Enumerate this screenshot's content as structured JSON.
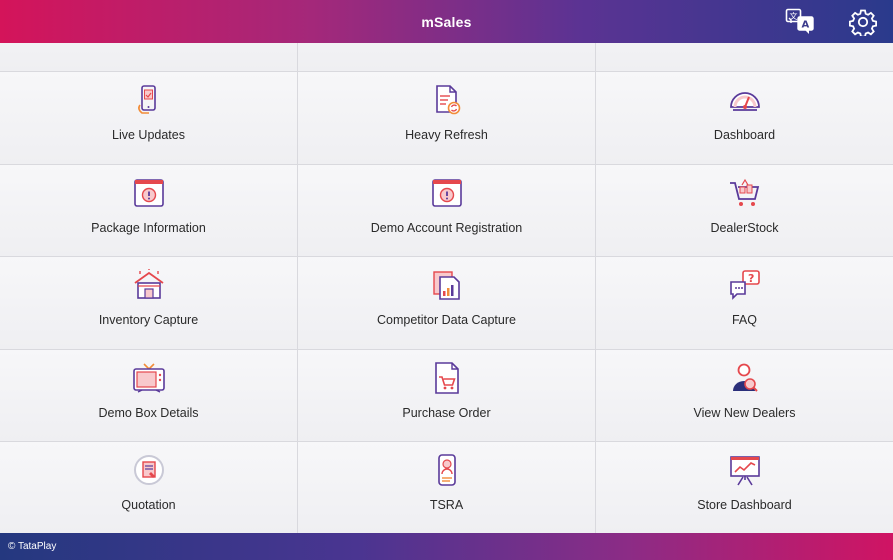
{
  "header": {
    "title": "mSales",
    "translate_icon": "translate-icon",
    "settings_icon": "gear-icon"
  },
  "rows": [
    [
      {
        "label": "Live Updates",
        "icon": "phone-update-icon"
      },
      {
        "label": "Heavy Refresh",
        "icon": "document-refresh-icon"
      },
      {
        "label": "Dashboard",
        "icon": "speedometer-icon"
      }
    ],
    [
      {
        "label": "Package Information",
        "icon": "info-box-icon"
      },
      {
        "label": "Demo Account Registration",
        "icon": "info-box-icon"
      },
      {
        "label": "DealerStock",
        "icon": "shopping-cart-icon"
      }
    ],
    [
      {
        "label": "Inventory Capture",
        "icon": "warehouse-icon"
      },
      {
        "label": "Competitor Data Capture",
        "icon": "documents-chart-icon"
      },
      {
        "label": "FAQ",
        "icon": "question-chat-icon"
      }
    ],
    [
      {
        "label": "Demo Box Details",
        "icon": "tv-icon"
      },
      {
        "label": "Purchase Order",
        "icon": "order-cart-icon"
      },
      {
        "label": "View New Dealers",
        "icon": "user-search-icon"
      }
    ],
    [
      {
        "label": "Quotation",
        "icon": "quotation-icon"
      },
      {
        "label": "TSRA",
        "icon": "id-card-icon"
      },
      {
        "label": "Store Dashboard",
        "icon": "presentation-chart-icon"
      }
    ]
  ],
  "footer": {
    "copyright": "© TataPlay"
  },
  "colors": {
    "accent_pink": "#d4145a",
    "accent_blue": "#2a3a8c",
    "icon_red": "#e5484d",
    "icon_purple": "#5a3a9a",
    "icon_orange": "#f28c38"
  }
}
